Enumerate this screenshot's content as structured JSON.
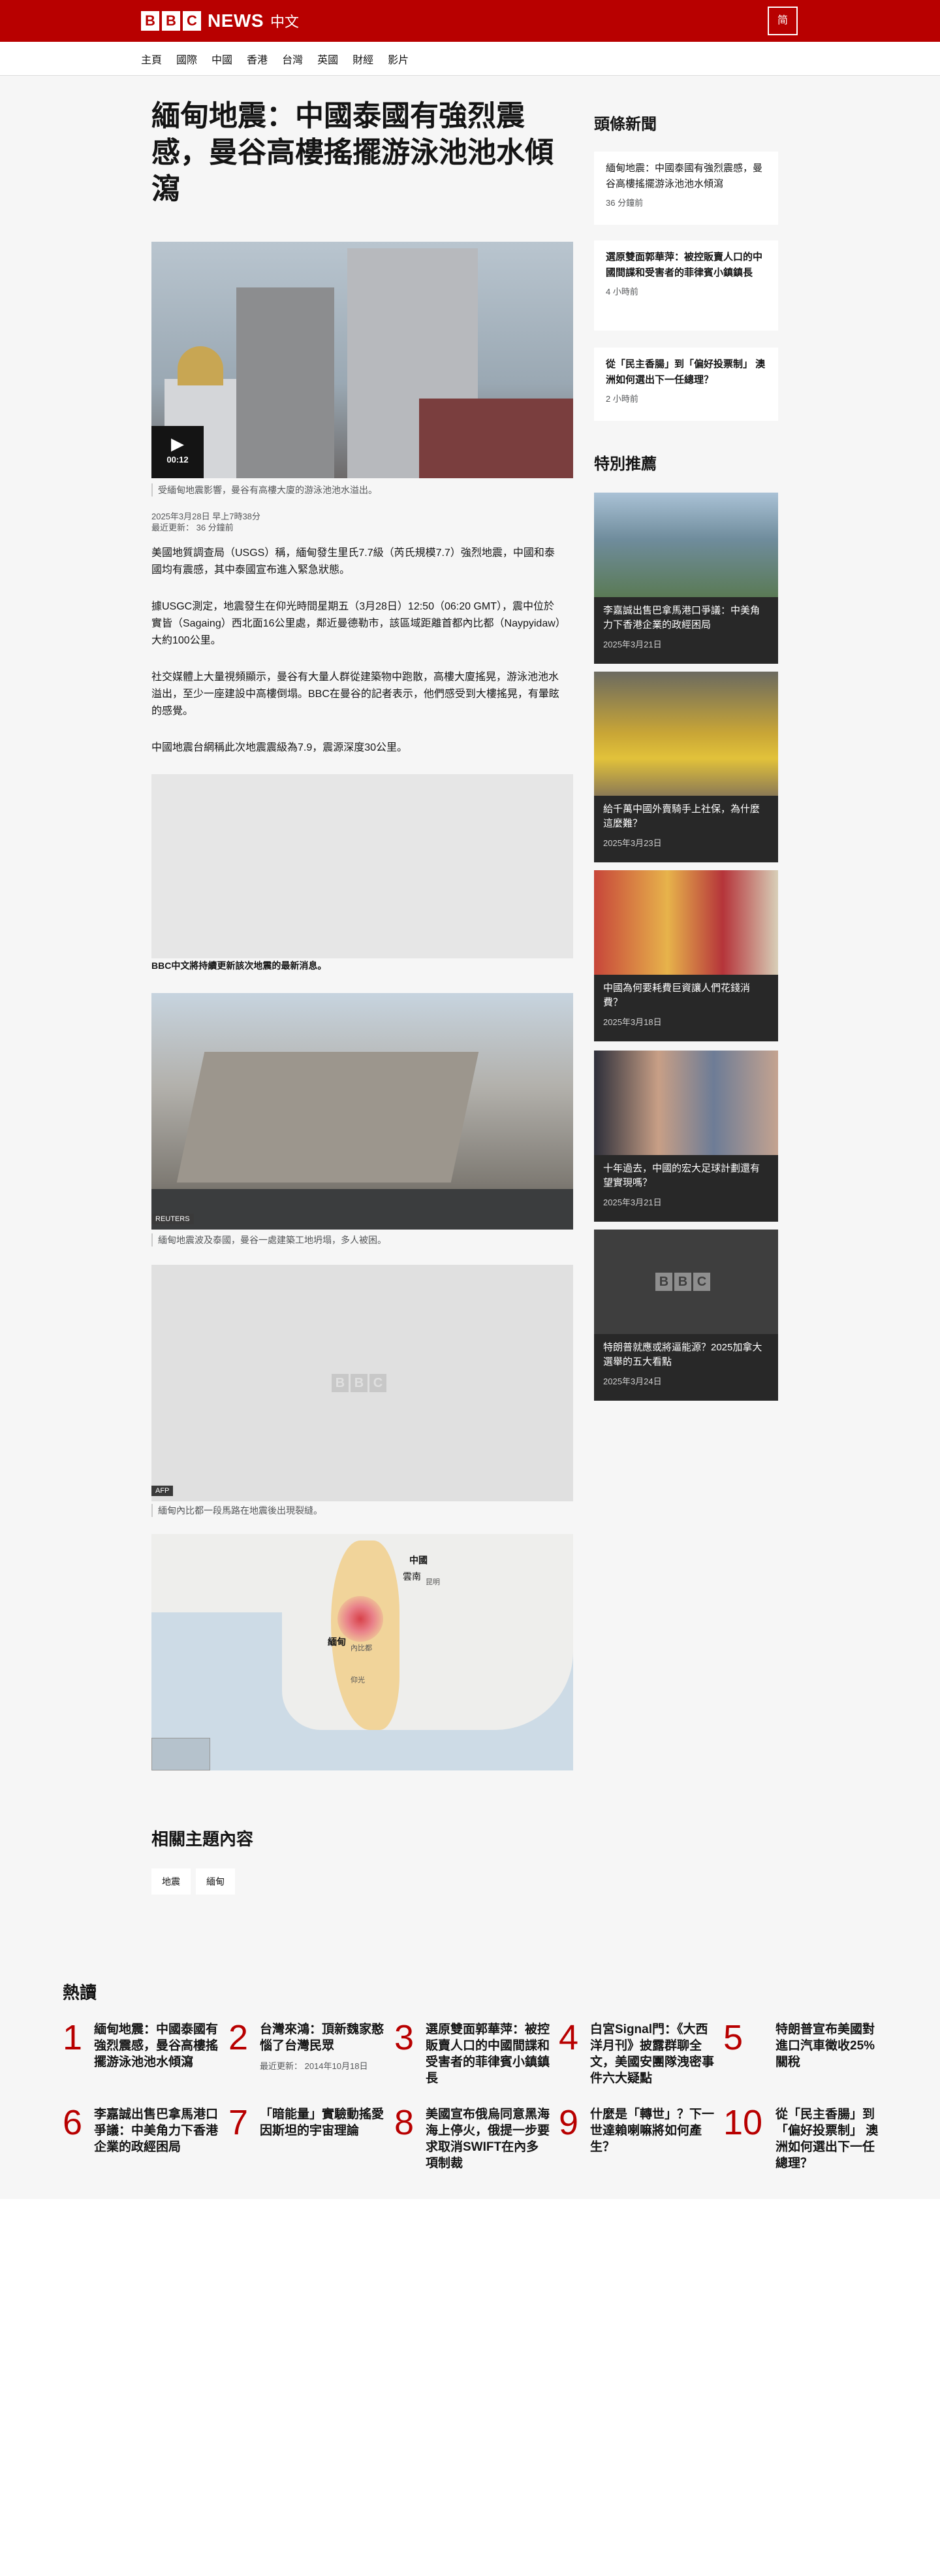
{
  "header": {
    "logo_letters": [
      "B",
      "B",
      "C"
    ],
    "brand": "NEWS",
    "language": "中文",
    "script_toggle": "简"
  },
  "nav": {
    "items": [
      {
        "label": "主頁"
      },
      {
        "label": "國際"
      },
      {
        "label": "中國"
      },
      {
        "label": "香港"
      },
      {
        "label": "台灣"
      },
      {
        "label": "英國"
      },
      {
        "label": "財經"
      },
      {
        "label": "影片"
      }
    ]
  },
  "article": {
    "headline": "緬甸地震：中國泰國有強烈震感，曼谷高樓搖擺游泳池池水傾瀉",
    "video_duration": "00:12",
    "video_caption": "受緬甸地震影響，曼谷有高樓大廈的游泳池池水溢出。",
    "published": "2025年3月28日 早上7時38分",
    "updated": "最近更新： 36 分鐘前",
    "paragraphs": [
      "美國地質調查局（USGS）稱，緬甸發生里氏7.7級（芮氏規模7.7）強烈地震，中國和泰國均有震感，其中泰國宣布進入緊急狀態。",
      "據USGC測定，地震發生在仰光時間星期五（3月28日）12:50（06:20 GMT），震中位於實皆（Sagaing）西北面16公里處，鄰近曼德勒市，該區域距離首都內比都（Naypyidaw）大約100公里。",
      "社交媒體上大量視頻顯示，曼谷有大量人群從建築物中跑散，高樓大廈搖晃，游泳池池水溢出，至少一座建設中高樓倒塌。BBC在曼谷的記者表示，他們感受到大樓搖晃，有暈眩的感覺。",
      "中國地震台網稱此次地震震級為7.9，震源深度30公里。"
    ],
    "embed_note": "BBC中文將持續更新該次地震的最新消息。",
    "image2_source": "REUTERS",
    "image2_caption": "緬甸地震波及泰國，曼谷一處建築工地坍塌，多人被困。",
    "image3_source": "AFP",
    "image3_caption": "緬甸內比都一段馬路在地震後出現裂縫。",
    "map_labels": {
      "china": "中國",
      "yunnan": "雲南",
      "kunming": "昆明",
      "myanmar": "緬甸",
      "naypyidaw": "內比都",
      "yangon": "仰光"
    }
  },
  "related": {
    "title": "相關主題內容",
    "topics": [
      "地震",
      "緬甸"
    ]
  },
  "sidebar": {
    "top_title": "頭條新聞",
    "top_stories": [
      {
        "title": "緬甸地震：中國泰國有強烈震感，曼谷高樓搖擺游泳池池水傾瀉",
        "time": "36 分鐘前"
      },
      {
        "title": "選原雙面郭華萍：被控販賣人口的中國間諜和受害者的菲律賓小鎮鎮長",
        "time": "4 小時前"
      },
      {
        "title": "從「民主香腸」到「偏好投票制」 澳洲如何選出下一任總理？",
        "time": "2 小時前"
      }
    ],
    "featured_title": "特別推薦",
    "featured": [
      {
        "title": "李嘉誠出售巴拿馬港口爭議：中美角力下香港企業的政經困局",
        "date": "2025年3月21日"
      },
      {
        "title": "給千萬中國外賣騎手上社保，為什麼這麼難？",
        "date": "2025年3月23日"
      },
      {
        "title": "中國為何要耗費巨資讓人們花錢消費？",
        "date": "2025年3月18日"
      },
      {
        "title": "十年過去，中國的宏大足球計劃還有望實現嗎？",
        "date": "2025年3月21日"
      },
      {
        "title": "特朗普就應或將逼能源？2025加拿大選舉的五大看點",
        "date": "2025年3月24日"
      }
    ]
  },
  "popular": {
    "title": "熱讀",
    "items": [
      {
        "rank": "1",
        "title": "緬甸地震：中國泰國有強烈震感，曼谷高樓搖擺游泳池池水傾瀉"
      },
      {
        "rank": "2",
        "title": "台灣來鴻：頂新魏家憨惱了台灣民眾",
        "meta": "最近更新： 2014年10月18日"
      },
      {
        "rank": "3",
        "title": "選原雙面郭華萍：被控販賣人口的中國間諜和受害者的菲律賓小鎮鎮長"
      },
      {
        "rank": "4",
        "title": "白宮Signal門：《大西洋月刊》披露群聊全文，美國安團隊洩密事件六大疑點"
      },
      {
        "rank": "5",
        "title": "特朗普宣布美國對進口汽車徵收25%關稅"
      },
      {
        "rank": "6",
        "title": "李嘉誠出售巴拿馬港口爭議：中美角力下香港企業的政經困局"
      },
      {
        "rank": "7",
        "title": "「暗能量」實驗動搖愛因斯坦的宇宙理論"
      },
      {
        "rank": "8",
        "title": "美國宣布俄烏同意黑海海上停火，俄提一步要求取消SWIFT在內多項制裁"
      },
      {
        "rank": "9",
        "title": "什麼是「轉世」？下一世達賴喇嘛將如何產生？"
      },
      {
        "rank": "10",
        "title": "從「民主香腸」到「偏好投票制」 澳洲如何選出下一任總理？"
      }
    ]
  }
}
